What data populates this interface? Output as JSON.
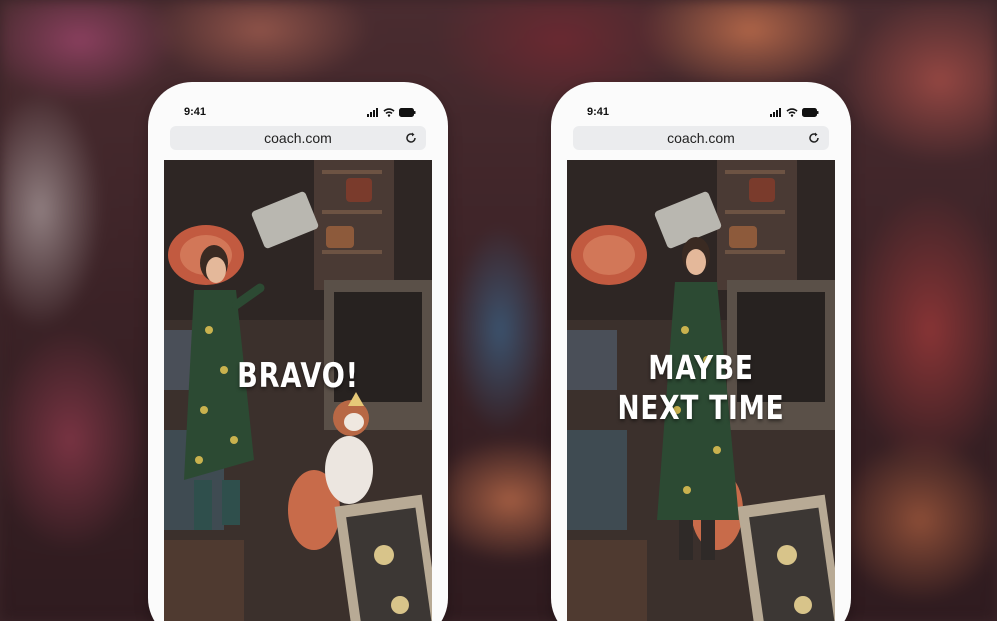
{
  "phones": [
    {
      "status_time": "9:41",
      "url": "coach.com",
      "overlay_lines": [
        "BRAVO!"
      ]
    },
    {
      "status_time": "9:41",
      "url": "coach.com",
      "overlay_lines": [
        "MAYBE",
        "NEXT TIME"
      ]
    }
  ],
  "icons": {
    "signal": "cellular-signal-icon",
    "wifi": "wifi-icon",
    "battery": "battery-icon",
    "reload": "reload-icon"
  },
  "colors": {
    "phone_frame": "#fbfbfb",
    "url_bar": "#ebecee",
    "overlay_text": "#ffffff"
  }
}
